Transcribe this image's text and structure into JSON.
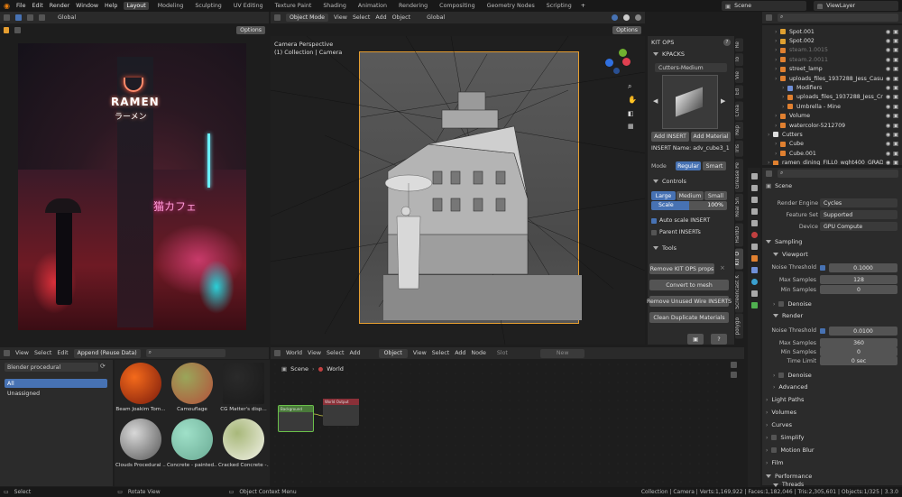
{
  "topbar": {
    "menus": [
      "File",
      "Edit",
      "Render",
      "Window",
      "Help"
    ],
    "workspaces": [
      "Layout",
      "Modeling",
      "Sculpting",
      "UV Editing",
      "Texture Paint",
      "Shading",
      "Animation",
      "Rendering",
      "Compositing",
      "Geometry Nodes",
      "Scripting"
    ],
    "active_workspace": "Layout",
    "scene_field": "Scene",
    "viewlayer_field": "ViewLayer"
  },
  "left_editor": {
    "orientation": "Global",
    "options": "Options",
    "ramen_sign": "RAMEN",
    "ramen_sub": "ラーメン",
    "cafe_sign": "猫カフェ"
  },
  "viewport": {
    "mode": "Object Mode",
    "menus": [
      "View",
      "Select",
      "Add",
      "Object"
    ],
    "orientation": "Global",
    "options": "Options",
    "camera_title": "Camera Perspective",
    "camera_sub": "(1) Collection | Camera"
  },
  "kitops": {
    "title": "KIT OPS",
    "kpacks_label": "KPACKS",
    "kpack_select": "Cutters-Medium",
    "add_insert": "Add INSERT",
    "add_material": "Add Material",
    "insert_name": "INSERT Name: adv_cube3_1",
    "mode_label": "Mode",
    "mode_regular": "Regular",
    "mode_smart": "Smart",
    "controls_label": "Controls",
    "size_large": "Large",
    "size_medium": "Medium",
    "size_small": "Small",
    "scale_label": "Scale",
    "scale_value": "100%",
    "auto_scale": "Auto scale INSERT",
    "parent_inserts": "Parent INSERTs",
    "tools_label": "Tools",
    "remove_props": "Remove KIT OPS props",
    "convert_mesh": "Convert to mesh",
    "remove_wire": "Remove Unused Wire INSERTS",
    "clean_materials": "Clean Duplicate Materials"
  },
  "side_tabs": [
    "Re",
    "To",
    "Vie",
    "Ed",
    "Crea",
    "Rep",
    "Tris",
    "Grease Pe",
    "Real Sn",
    "HardO",
    "KIT O",
    "Screencast K",
    "polygo"
  ],
  "outliner": {
    "rows": [
      {
        "name": "Spot.001",
        "color": "#e0a030",
        "indent": 1
      },
      {
        "name": "Spot.002",
        "color": "#e0a030",
        "indent": 1
      },
      {
        "name": "steam.1.0015",
        "color": "#e08030",
        "indent": 1,
        "dim": true
      },
      {
        "name": "steam.2.0011",
        "color": "#e08030",
        "indent": 1,
        "dim": true
      },
      {
        "name": "street_lamp",
        "color": "#e08030",
        "indent": 1
      },
      {
        "name": "uploads_files_1937288_Jess_Casua",
        "color": "#e08030",
        "indent": 1
      },
      {
        "name": "Modifiers",
        "color": "#6f8fd8",
        "indent": 2
      },
      {
        "name": "uploads_files_1937288_Jess_Cr",
        "color": "#e08030",
        "indent": 2
      },
      {
        "name": "Umbrella - Mine",
        "color": "#e08030",
        "indent": 2
      },
      {
        "name": "Volume",
        "color": "#e08030",
        "indent": 1
      },
      {
        "name": "watercolor-5212709",
        "color": "#e08030",
        "indent": 1
      },
      {
        "name": "Cutters",
        "color": "#dddddd",
        "indent": 0
      },
      {
        "name": "Cube",
        "color": "#e08030",
        "indent": 1
      },
      {
        "name": "Cube.001",
        "color": "#e08030",
        "indent": 1
      },
      {
        "name": "ramen_dining_FILL0_wght400_GRAD0",
        "color": "#e08030",
        "indent": 0
      }
    ]
  },
  "properties": {
    "scene_label": "Scene",
    "render_engine_label": "Render Engine",
    "render_engine": "Cycles",
    "feature_set_label": "Feature Set",
    "feature_set": "Supported",
    "device_label": "Device",
    "device": "GPU Compute",
    "sampling": "Sampling",
    "viewport": "Viewport",
    "noise_threshold_label": "Noise Threshold",
    "viewport_noise": "0.1000",
    "max_samples_label": "Max Samples",
    "viewport_max": "128",
    "min_samples_label": "Min Samples",
    "viewport_min": "0",
    "denoise": "Denoise",
    "render": "Render",
    "render_noise": "0.0100",
    "render_max": "360",
    "render_min": "0",
    "time_limit_label": "Time Limit",
    "time_limit": "0 sec",
    "denoise2": "Denoise",
    "advanced": "Advanced",
    "light_paths": "Light Paths",
    "volumes": "Volumes",
    "curves": "Curves",
    "simplify": "Simplify",
    "motion_blur": "Motion Blur",
    "film": "Film",
    "performance": "Performance",
    "threads": "Threads"
  },
  "asset_browser": {
    "menus": [
      "View",
      "Select",
      "Edit"
    ],
    "import_mode": "Append (Reuse Data)",
    "library": "Blender procedural",
    "catalog_all": "All",
    "catalog_unassigned": "Unassigned",
    "assets": [
      {
        "name": "Beam Joakim Tom...",
        "c1": "#f46a1b",
        "c2": "#7a1a0c"
      },
      {
        "name": "Camouflage",
        "c1": "#9aa65a",
        "c2": "#b4503a"
      },
      {
        "name": "CG Matter's disp...",
        "c1": "#2a2a2a",
        "c2": "#1a1a1a"
      },
      {
        "name": "Clouds Procedural ...",
        "c1": "#d8d8d8",
        "c2": "#555555"
      },
      {
        "name": "Concrete - painted...",
        "c1": "#9fe0c8",
        "c2": "#6aaa94"
      },
      {
        "name": "Cracked Concrete -...",
        "c1": "#a8b87a",
        "c2": "#f2f2e8"
      }
    ]
  },
  "node_editor": {
    "world_select": "World",
    "menus": [
      "View",
      "Select",
      "Add"
    ],
    "object_select": "Object",
    "menus2": [
      "View",
      "Select",
      "Add",
      "Node"
    ],
    "slot": "Slot",
    "new_label": "New",
    "breadcrumb_scene": "Scene",
    "breadcrumb_world": "World",
    "node1_title": "Background",
    "node2_title": "World Output"
  },
  "statusbar": {
    "select": "Select",
    "rotate_view": "Rotate View",
    "context_menu": "Object Context Menu",
    "stats": "Collection | Camera | Verts:1,169,922 | Faces:1,182,046 | Tris:2,305,601 | Objects:1/325 | 3.3.0"
  },
  "colors": {
    "accent": "#4772b3",
    "object_orange": "#e08030",
    "selection_outline": "#e69e30"
  }
}
